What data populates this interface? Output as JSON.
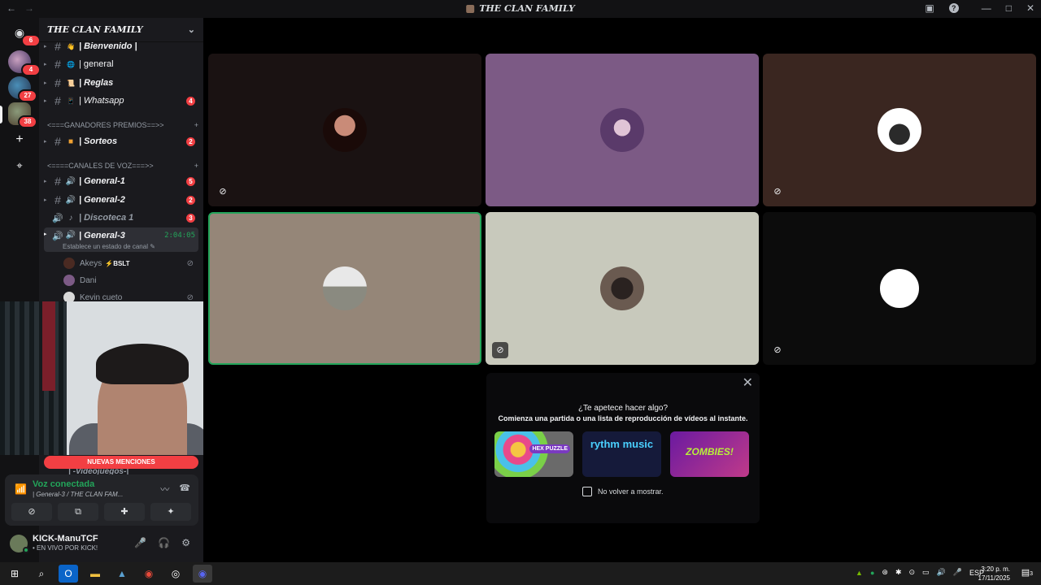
{
  "window": {
    "title": "THE CLAN FAMILY",
    "back": "←",
    "forward": "→",
    "inbox_icon": "inbox-icon",
    "help": "?"
  },
  "rail": {
    "home_badge": "6",
    "servers": [
      {
        "badge": "4"
      },
      {
        "badge": "27"
      },
      {
        "badge": "38"
      }
    ],
    "add": "+",
    "explore": "⌖"
  },
  "guild": {
    "name": "THE CLAN FAMILY",
    "chevron": "⌄"
  },
  "channels": [
    {
      "name": "| Bienvenido |",
      "emoji": "👋",
      "count": ""
    },
    {
      "name": "| general",
      "emoji": "🌐",
      "count": ""
    },
    {
      "name": "| Reglas",
      "emoji": "📜",
      "count": ""
    },
    {
      "name": "| Whatsapp",
      "emoji": "📱",
      "count": "4"
    }
  ],
  "categories": {
    "prizes": "<===GANADORES PREMIOS==>>",
    "voice": "<====CANALES DE VOZ===>>"
  },
  "prize_channel": {
    "name": "| Sorteos",
    "count": "2"
  },
  "voice_channels": [
    {
      "name": "| General-1",
      "count": "5"
    },
    {
      "name": "| General-2",
      "count": "2"
    },
    {
      "name": "| Discoteca 1",
      "count": "3"
    }
  ],
  "active_voice": {
    "name": "| General-3",
    "timer": "2:04:05",
    "status_hint": "Establece un estado de canal"
  },
  "members": [
    {
      "name": "Akeys",
      "tag": "⚡BSLT"
    },
    {
      "name": "Dani",
      "tag": ""
    },
    {
      "name": "Kevin cueto",
      "tag": ""
    }
  ],
  "hidden_channel": "| -Videojuegos-|",
  "mentions_banner": "NUEVAS MENCIONES",
  "voice_panel": {
    "status": "Voz conectada",
    "location": "| General-3 / THE CLAN FAM...",
    "buttons": [
      "camera-off",
      "screen-share",
      "activities",
      "soundboard"
    ]
  },
  "user": {
    "name": "KICK-ManuTCF",
    "status": "• EN VIVO POR KICK!"
  },
  "activity": {
    "question": "¿Te apetece hacer algo?",
    "description": "Comienza una partida o una lista de reproducción de vídeos al instante.",
    "games": [
      "HEX PUZZLE",
      "rythm music",
      "ZOMBIES!"
    ],
    "dont_show": "No volver a mostrar."
  },
  "taskbar": {
    "lang": "ESP",
    "time": "3:20 p. m.",
    "date": "17/11/2025",
    "notifications": "3"
  },
  "colors": {
    "tile1": "#1a1212",
    "tile2": "#7c5a85",
    "tile3": "#3a2620",
    "tile4": "#958678",
    "tile5": "#c8c9bc",
    "tile6": "#0c0c0c",
    "speaking_border": "#23a55a"
  }
}
